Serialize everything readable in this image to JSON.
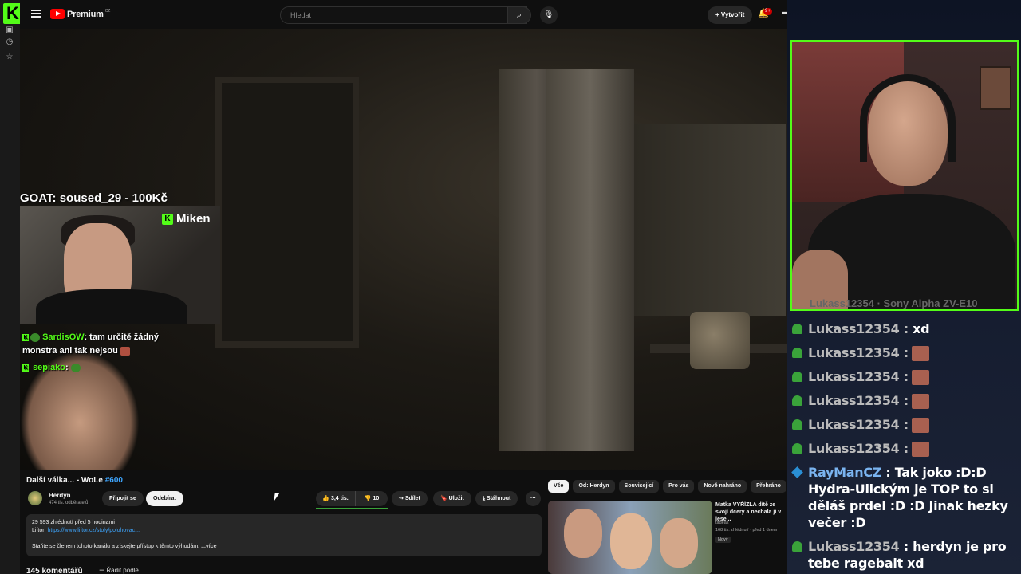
{
  "browser": {
    "kick_logo": "K"
  },
  "header": {
    "logo_text": "Premium",
    "country": "CZ",
    "search_placeholder": "Hledat",
    "create_label": "Vytvořit",
    "notifications_badge": "9+",
    "create_icon": "plus-icon",
    "search_icon": "search-icon",
    "mic_icon": "microphone-icon"
  },
  "video_overlay": {
    "goat": "GOAT: soused_29 - 100Kč",
    "cam_name": "Miken",
    "kick_chat": [
      {
        "user": "SardisOW",
        "text": ": tam určitě žádný"
      },
      {
        "user": "",
        "text": "monstra ani tak nejsou"
      },
      {
        "user": "sepiako",
        "text": ":"
      }
    ]
  },
  "video": {
    "title": "Další válka... - WoLe",
    "hashtag": "#600",
    "channel": "Herdyn",
    "subscribers": "474 tis. odběratelů",
    "join_label": "Připojit se",
    "subscribe_label": "Odebírat",
    "likes": "3,4 tis.",
    "dislikes": "10",
    "share_label": "Sdílet",
    "save_label": "Uložit",
    "download_label": "Stáhnout",
    "more_label": "···"
  },
  "description": {
    "views": "29 593 zhlédnutí  před 5 hodinami",
    "liftor_label": "Liftor:",
    "liftor_link": "https://www.liftor.cz/stoly/polohovac...",
    "member_text": "Staňte se členem tohoto kanálu a získejte přístup k těmto výhodám:",
    "more_label": "...více"
  },
  "comments": {
    "count": "145 komentářů",
    "sort_label": "Řadit podle"
  },
  "related": {
    "chips": [
      "Vše",
      "Od: Herdyn",
      "Související",
      "Pro vás",
      "Nově nahráno",
      "Přehráno"
    ],
    "active_chip": "Vše",
    "video_title": "Matka VYŘÍZLA dítě ze svojí dcery a nechala ji v lese...",
    "video_channel": "tadeas",
    "video_meta": "168 tis. zhlédnutí · před 1 dnem",
    "video_badge": "Nový"
  },
  "streamer_cam": {
    "label": "Lukass12354 · Sony Alpha ZV-E10"
  },
  "chat": [
    {
      "icon": "user-icon",
      "name": "Lukass12354",
      "sep": " :",
      "text": " xd",
      "emote": false
    },
    {
      "icon": "user-icon",
      "name": "Lukass12354",
      "sep": " :",
      "text": "",
      "emote": true
    },
    {
      "icon": "user-icon",
      "name": "Lukass12354",
      "sep": " :",
      "text": "",
      "emote": true
    },
    {
      "icon": "user-icon",
      "name": "Lukass12354",
      "sep": " :",
      "text": "",
      "emote": true
    },
    {
      "icon": "user-icon",
      "name": "Lukass12354",
      "sep": " :",
      "text": "",
      "emote": true
    },
    {
      "icon": "user-icon",
      "name": "Lukass12354",
      "sep": " :",
      "text": "",
      "emote": true
    },
    {
      "icon": "cube-icon",
      "name": "RayManCZ",
      "sep": " :",
      "text": " Tak joko :D:D Hydra-Ulickým je TOP to si děláš prdel :D :D Jinak hezky večer :D",
      "emote": false
    },
    {
      "icon": "user-icon",
      "name": "Lukass12354",
      "sep": " :",
      "text": " herdyn je pro tebe ragebait xd",
      "emote": false
    }
  ],
  "colors": {
    "kick_green": "#53fc18",
    "yt_red": "#ff0000",
    "link_blue": "#3ea6ff"
  }
}
